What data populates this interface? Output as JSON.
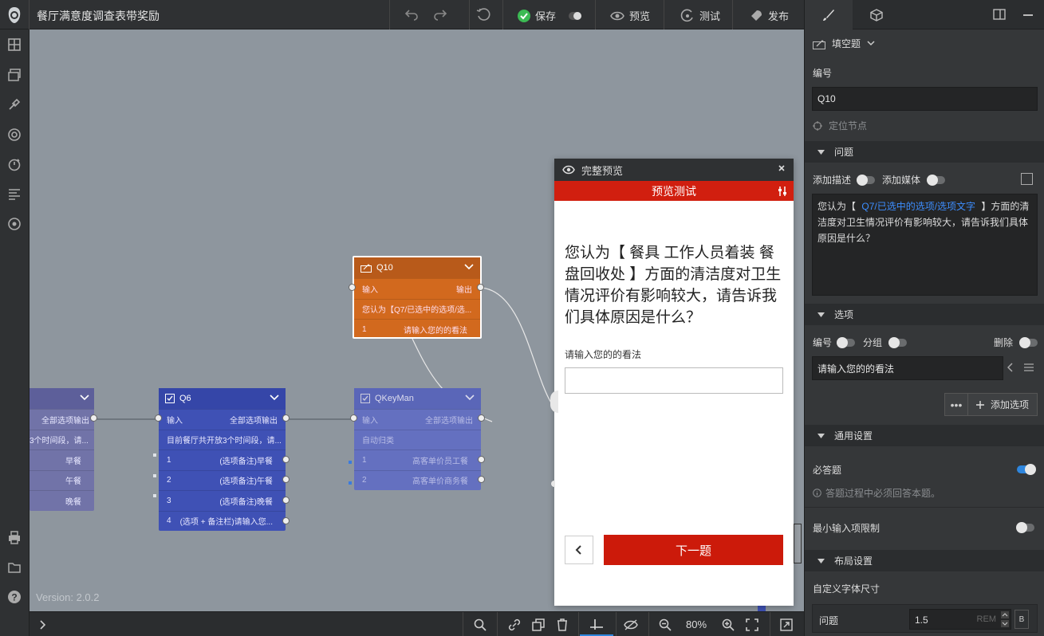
{
  "app": {
    "title": "餐厅满意度调查表带奖励",
    "version": "Version: 2.0.2"
  },
  "toolbar": {
    "save": "保存",
    "preview": "预览",
    "test": "测试",
    "publish": "发布"
  },
  "canvas": {
    "nodes": {
      "left_partial": {
        "output": "全部选项输出",
        "desc": "3个时间段，请...",
        "rows": [
          "早餐",
          "午餐",
          "晚餐"
        ]
      },
      "q6": {
        "title": "Q6",
        "input": "输入",
        "output": "全部选项输出",
        "desc": "目前餐厅共开放3个时间段，请...",
        "rows": [
          {
            "num": "1",
            "label": "(选项备注)早餐"
          },
          {
            "num": "2",
            "label": "(选项备注)午餐"
          },
          {
            "num": "3",
            "label": "(选项备注)晚餐"
          },
          {
            "num": "4",
            "label": "(选项 + 备注栏)请输入您..."
          }
        ]
      },
      "qkeyman": {
        "title": "QKeyMan",
        "input": "输入",
        "output": "全部选项输出",
        "desc": "自动归类",
        "rows": [
          {
            "num": "1",
            "label": "高客单价员工餐"
          },
          {
            "num": "2",
            "label": "高客单价商务餐"
          }
        ]
      },
      "q10": {
        "title": "Q10",
        "input": "输入",
        "output": "输出",
        "desc": "您认为【Q7/已选中的选项/选...",
        "rows": [
          {
            "num": "1",
            "label": "请输入您的的看法"
          }
        ]
      }
    }
  },
  "preview": {
    "header": "完整预览",
    "bar": "预览测试",
    "question": "您认为【 餐具 工作人员着装 餐盘回收处 】方面的清洁度对卫生情况评价有影响较大，请告诉我们具体原因是什么？",
    "input_label": "请输入您的的看法",
    "next": "下一题"
  },
  "bottombar": {
    "zoom": "80%"
  },
  "panel": {
    "type_select": "填空题",
    "id_label": "编号",
    "id_value": "Q10",
    "locate": "定位节点",
    "question_section": "问题",
    "add_desc": "添加描述",
    "add_media": "添加媒体",
    "question_text_prefix": "您认为【",
    "question_text_ref": "Q7/已选中的选项/选项文字",
    "question_text_suffix": "】方面的清洁度对卫生情况评价有影响较大，请告诉我们具体原因是什么？",
    "options_section": "选项",
    "opt_numbering": "编号",
    "opt_group": "分组",
    "opt_delete": "删除",
    "option_value": "请输入您的的看法",
    "add_option": "添加选项",
    "general_section": "通用设置",
    "required": "必答题",
    "required_hint": "答题过程中必须回答本题。",
    "min_inputs": "最小输入项限制",
    "layout_section": "布局设置",
    "font_size_label": "自定义字体尺寸",
    "font_row_label": "问题",
    "font_value": "1.5",
    "font_unit": "REM",
    "font_b": "B"
  },
  "colors": {
    "q6": "#3f51b5",
    "qkeyman": "#6a75c0",
    "q10": "#d2691e",
    "accent_red": "#d11f0f",
    "switch_on": "#2e86de"
  }
}
